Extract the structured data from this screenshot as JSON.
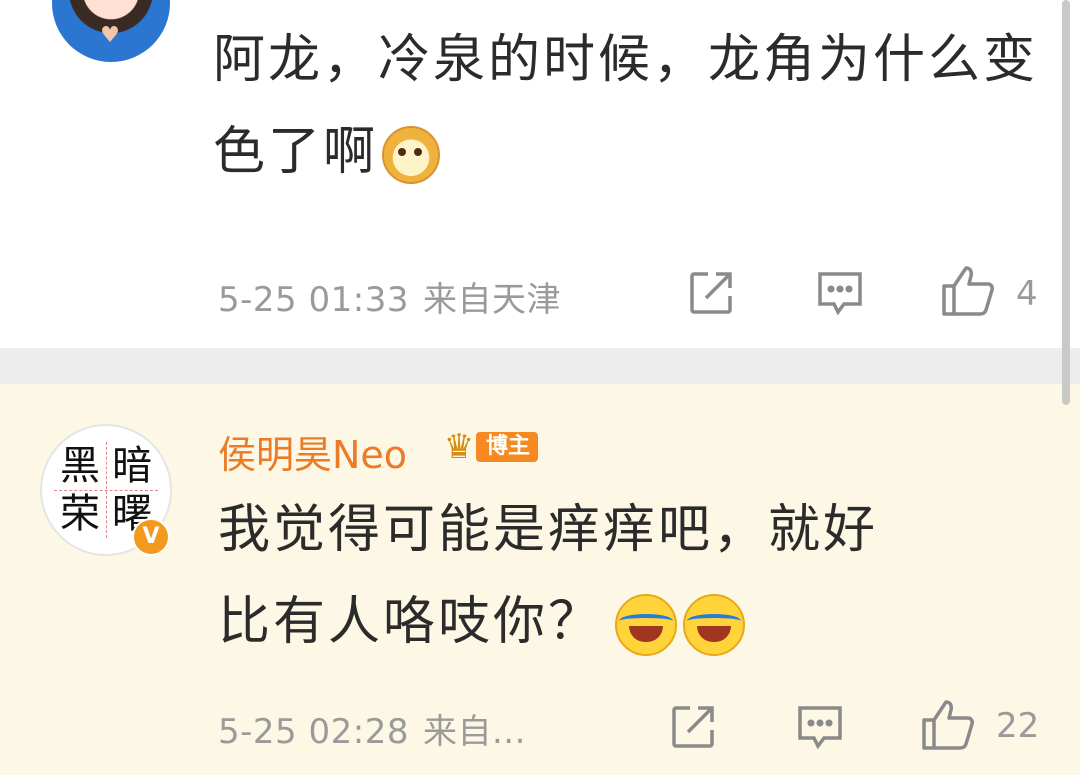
{
  "comments": [
    {
      "text": "阿龙，冷泉的时候，龙角为什么变色了啊",
      "emoji": "doge-emoji",
      "timestamp": "5-25 01:33",
      "location": "来自天津",
      "likes": "4"
    },
    {
      "username": "侯明昊Neo",
      "badge_label": "博主",
      "avatar_chars": [
        "黑",
        "暗",
        "荣",
        "曙"
      ],
      "verified_mark": "V",
      "text_line1": "我觉得可能是痒痒吧，就好",
      "text_line2": "比有人咯吱你？",
      "emojis": [
        "laugh-cry-emoji",
        "laugh-cry-emoji"
      ],
      "timestamp": "5-25 02:28",
      "location": "来自...",
      "likes": "22"
    }
  ],
  "colors": {
    "username": "#eb7b27",
    "highlight_bg": "#fdf8e6",
    "separator": "#ededed",
    "meta_text": "#9a9a9a",
    "body_text": "#2b2b2b",
    "badge": "#f68a21"
  },
  "icons": [
    "share-icon",
    "comment-icon",
    "like-icon"
  ]
}
